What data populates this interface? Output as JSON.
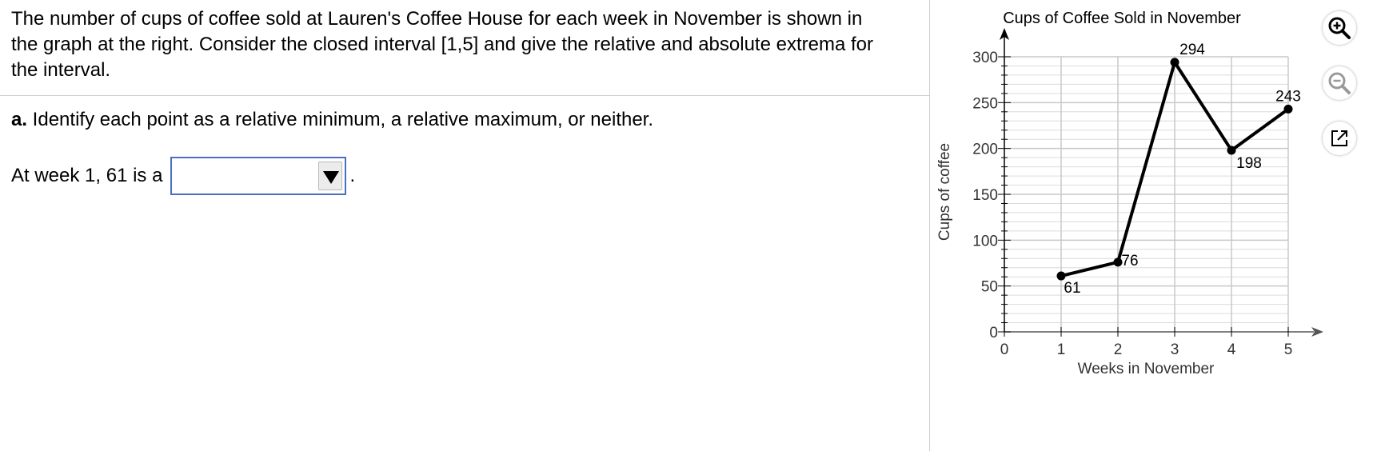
{
  "problem": {
    "text": "The number of cups of coffee sold at Lauren's Coffee House for each week in November is shown in the graph at the right. Consider the closed interval [1,5] and give the relative and absolute extrema for the interval.",
    "part_label": "a.",
    "part_text": " Identify each point as a relative minimum, a relative maximum, or neither.",
    "answer_prefix": "At week 1, 61 is a",
    "answer_selected": "",
    "answer_suffix": "."
  },
  "tools": {
    "zoom_in": "zoom-in-icon",
    "zoom_out": "zoom-out-icon",
    "popout": "popout-icon"
  },
  "chart_data": {
    "type": "line",
    "title": "Cups of Coffee Sold in November",
    "xlabel": "Weeks in November",
    "ylabel": "Cups of coffee",
    "x": [
      1,
      2,
      3,
      4,
      5
    ],
    "values": [
      61,
      76,
      294,
      198,
      243
    ],
    "point_labels": [
      "61",
      "76",
      "294",
      "198",
      "243"
    ],
    "xlim": [
      0,
      5
    ],
    "ylim": [
      0,
      300
    ],
    "xticks": [
      0,
      1,
      2,
      3,
      4,
      5
    ],
    "yticks": [
      0,
      50,
      100,
      150,
      200,
      250,
      300
    ],
    "xtick_labels": [
      "0",
      "1",
      "2",
      "3",
      "4",
      "5"
    ],
    "ytick_labels": [
      "0",
      "50",
      "100",
      "150",
      "200",
      "250",
      "300"
    ],
    "grid": true,
    "line_color": "#000000",
    "grid_color": "#c8c8c8"
  }
}
